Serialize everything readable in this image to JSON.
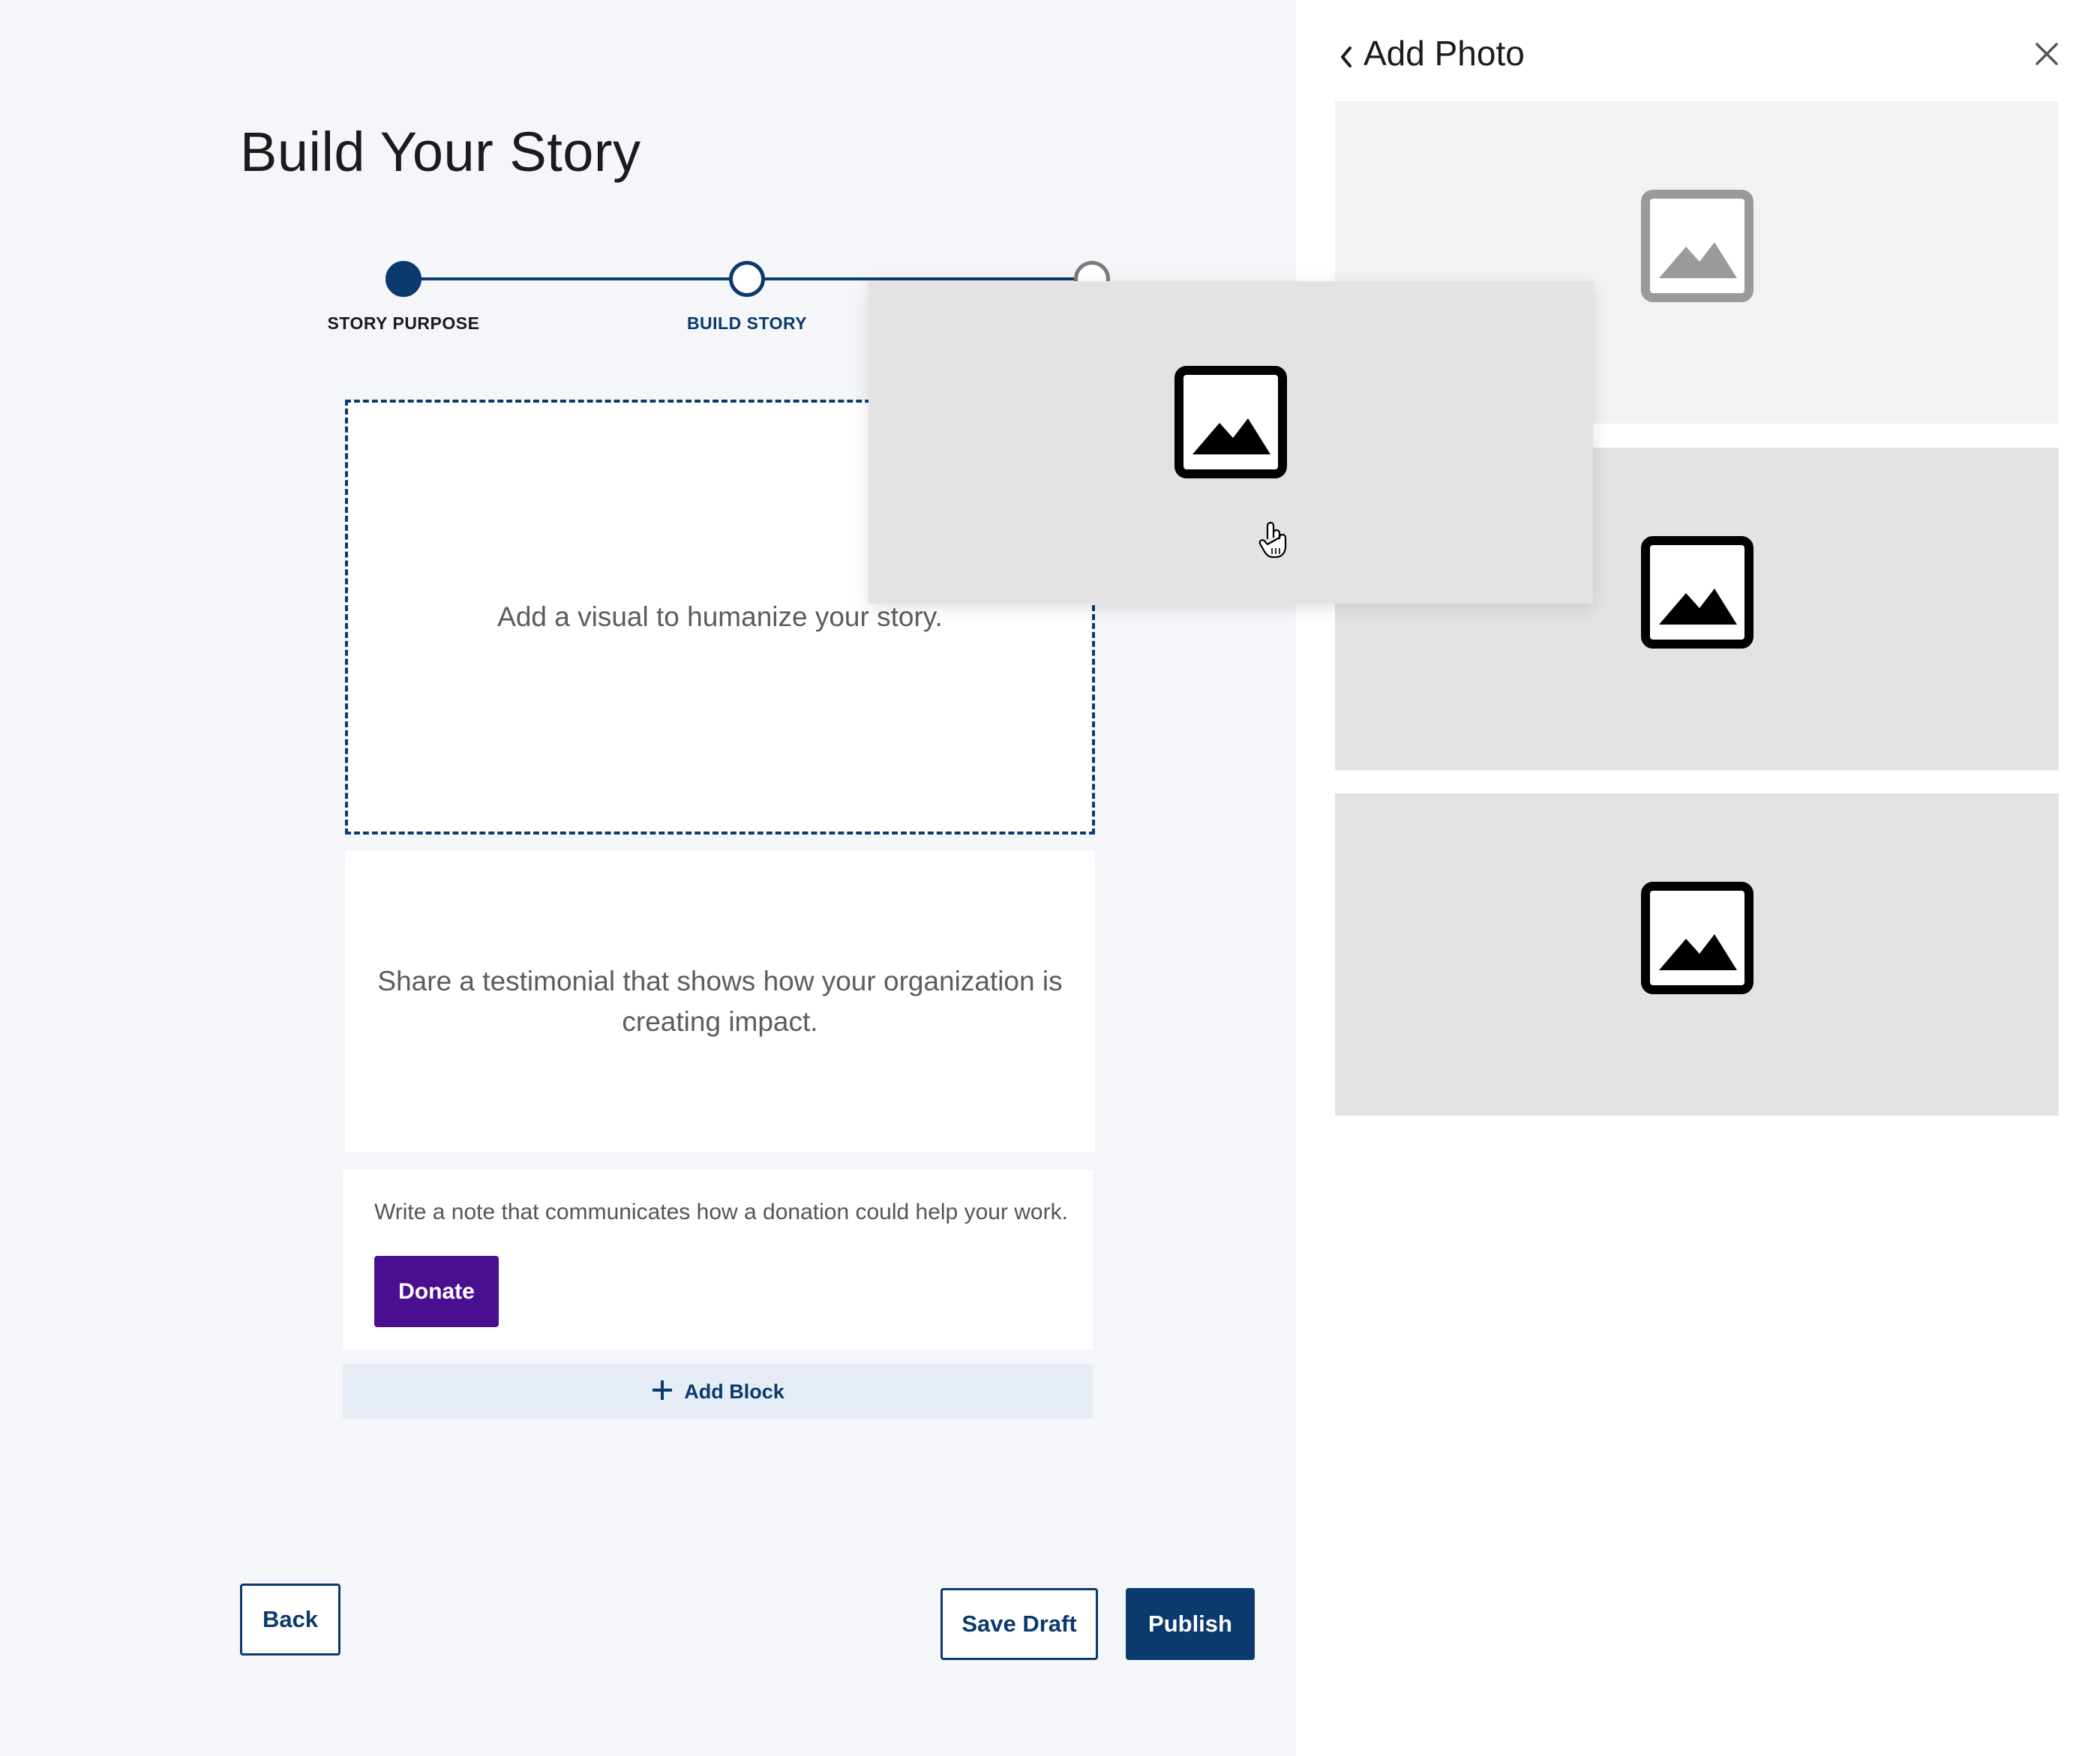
{
  "page": {
    "title": "Build Your Story"
  },
  "stepper": {
    "steps": [
      {
        "label": "STORY PURPOSE",
        "state": "complete"
      },
      {
        "label": "BUILD STORY",
        "state": "current"
      },
      {
        "label": "",
        "state": "upcoming"
      }
    ]
  },
  "blocks": {
    "visual_placeholder": "Add a visual to humanize your story.",
    "testimonial_placeholder": "Share a testimonial that shows how your organization is creating impact.",
    "donation_note": "Write a note that communicates how a donation could help your work.",
    "donate_label": "Donate",
    "add_block_label": "Add Block"
  },
  "footer": {
    "back_label": "Back",
    "save_draft_label": "Save Draft",
    "publish_label": "Publish"
  },
  "panel": {
    "title": "Add Photo",
    "back_icon": "chevron-left-icon",
    "close_icon": "close-icon",
    "photos": [
      {
        "icon": "image-icon",
        "state": "being-dragged"
      },
      {
        "icon": "image-icon",
        "state": "available"
      },
      {
        "icon": "image-icon",
        "state": "available"
      }
    ]
  },
  "colors": {
    "primary": "#0b3a6e",
    "donate": "#4a0f91",
    "background": "#f4f6fa",
    "panel": "#ffffff",
    "placeholder_card": "#e3e3e3"
  }
}
